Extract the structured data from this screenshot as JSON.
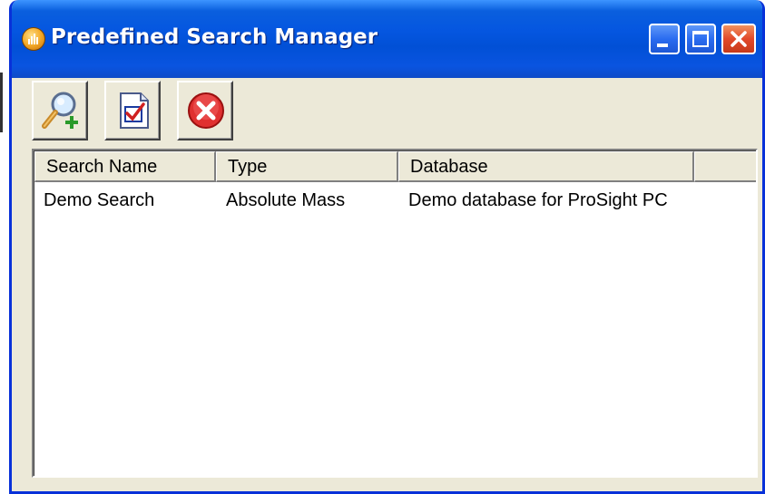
{
  "window": {
    "title": "Predefined Search Manager"
  },
  "toolbar": {
    "buttons": [
      {
        "name": "new-search",
        "icon": "magnifier-plus-icon"
      },
      {
        "name": "edit-search",
        "icon": "document-check-icon"
      },
      {
        "name": "delete-search",
        "icon": "red-x-circle-icon"
      }
    ]
  },
  "list": {
    "columns": [
      "Search Name",
      "Type",
      "Database",
      ""
    ],
    "rows": [
      {
        "search_name": "Demo Search",
        "type": "Absolute Mass",
        "database": "Demo database for ProSight PC"
      }
    ]
  },
  "colors": {
    "titlebar": "#0556e0",
    "chrome": "#ece9d8",
    "close_button": "#e2492a"
  }
}
